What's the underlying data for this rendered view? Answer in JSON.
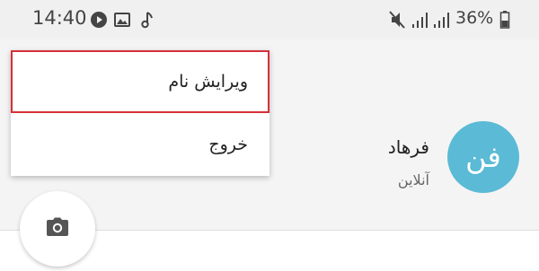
{
  "status_bar": {
    "time": "14:40",
    "left_icons": [
      "play-icon",
      "image-icon",
      "music-note-icon"
    ],
    "right_icons": [
      "mute-icon",
      "signal-icon",
      "signal-icon",
      "battery-icon"
    ],
    "battery_percent": "36%"
  },
  "menu": {
    "items": [
      {
        "label": "ویرایش نام",
        "highlighted": true
      },
      {
        "label": "خروج"
      }
    ]
  },
  "profile": {
    "avatar_initials": "فن",
    "avatar_color": "#5bbad5",
    "name": "فرهاد",
    "status": "آنلاین"
  },
  "colors": {
    "highlight": "#d6303a"
  },
  "camera_button_icon": "camera-icon"
}
